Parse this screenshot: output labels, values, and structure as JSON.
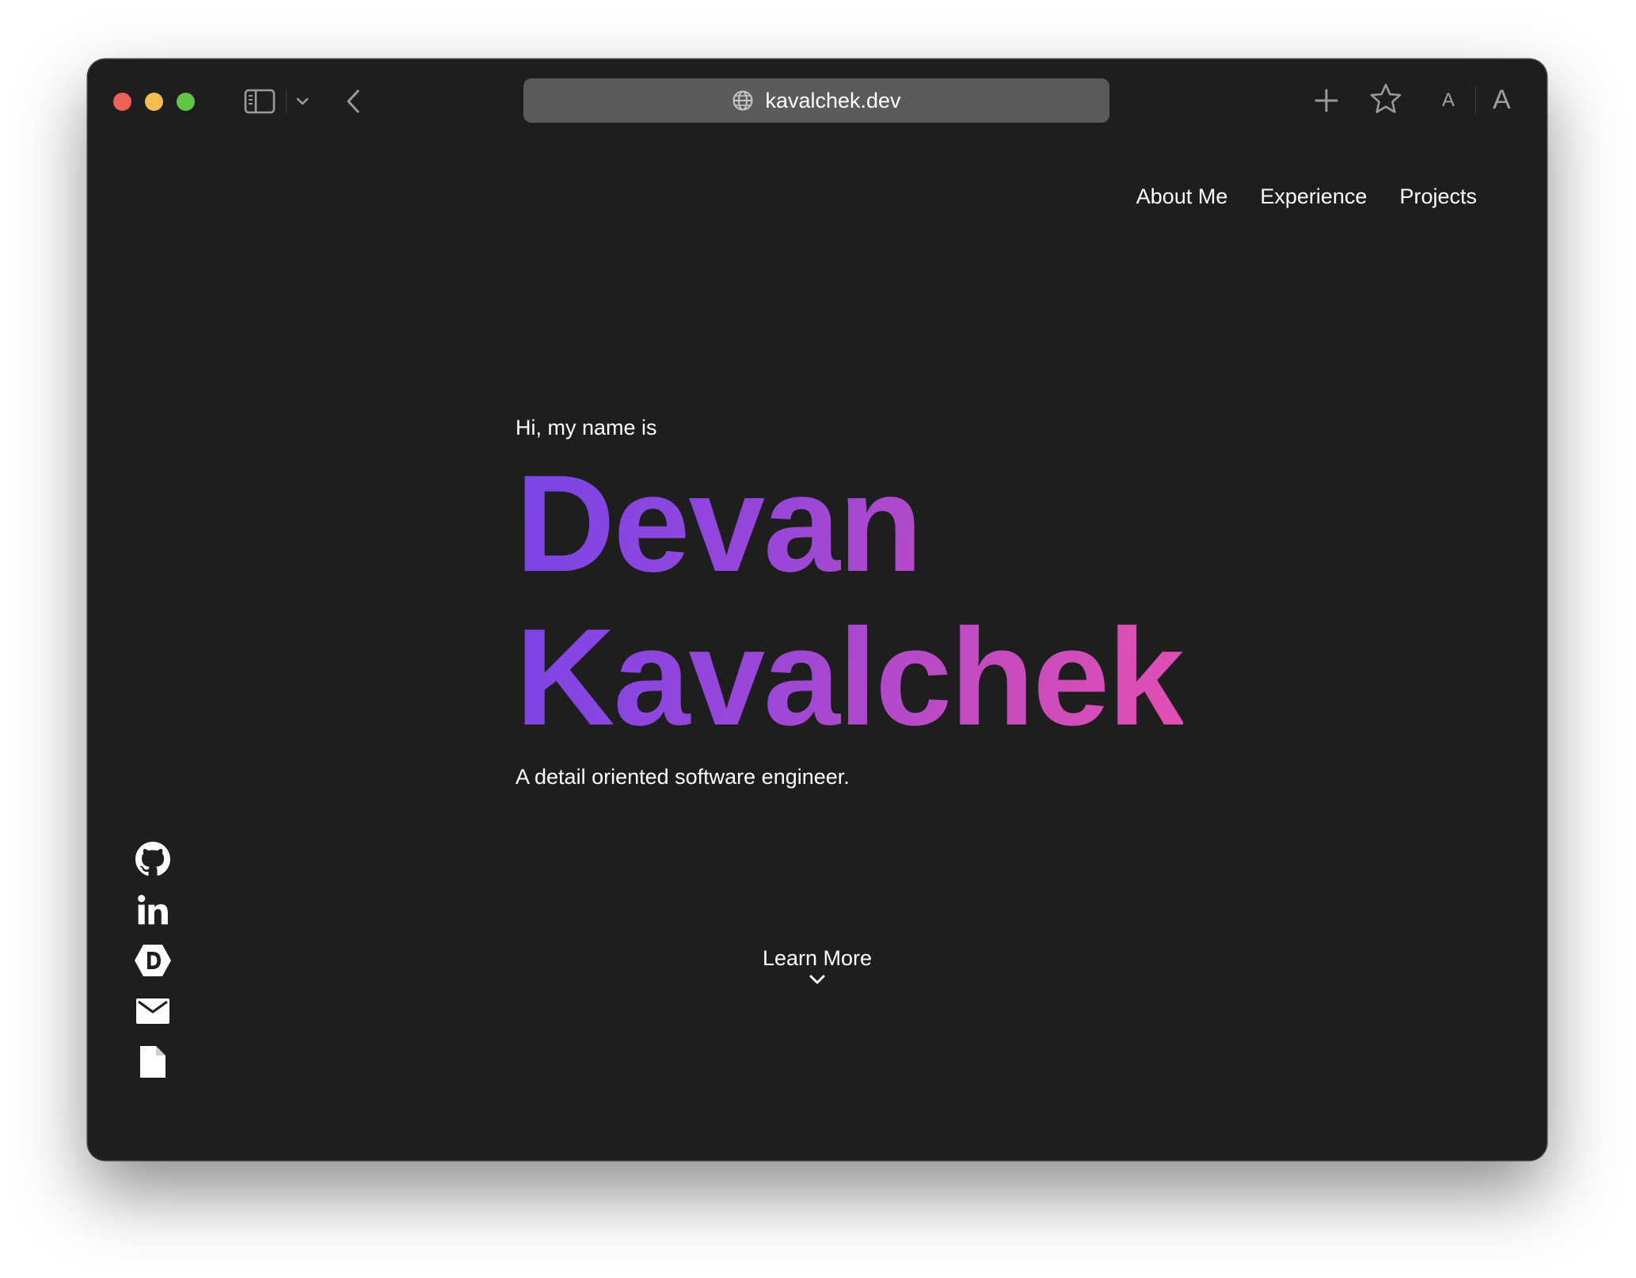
{
  "browser": {
    "url": "kavalchek.dev",
    "traffic_lights": {
      "close": "#ee5f57",
      "minimize": "#f5bd4f",
      "zoom": "#5ec642"
    },
    "text_size_small": "A",
    "text_size_large": "A"
  },
  "nav": {
    "items": [
      {
        "label": "About Me"
      },
      {
        "label": "Experience"
      },
      {
        "label": "Projects"
      }
    ]
  },
  "hero": {
    "greeting": "Hi, my name is",
    "first_name": "Devan",
    "last_name": "Kavalchek",
    "tagline": "A detail oriented software engineer.",
    "gradient": [
      "#7a44e8",
      "#e24fb2"
    ]
  },
  "socials": [
    {
      "icon": "github-icon"
    },
    {
      "icon": "linkedin-icon"
    },
    {
      "icon": "dev-icon"
    },
    {
      "icon": "email-icon"
    },
    {
      "icon": "resume-icon"
    }
  ],
  "learn_more": {
    "label": "Learn More"
  },
  "colors": {
    "background": "#1e1e1f",
    "text": "#ffffff",
    "urlbar": "#5b5b5d"
  }
}
